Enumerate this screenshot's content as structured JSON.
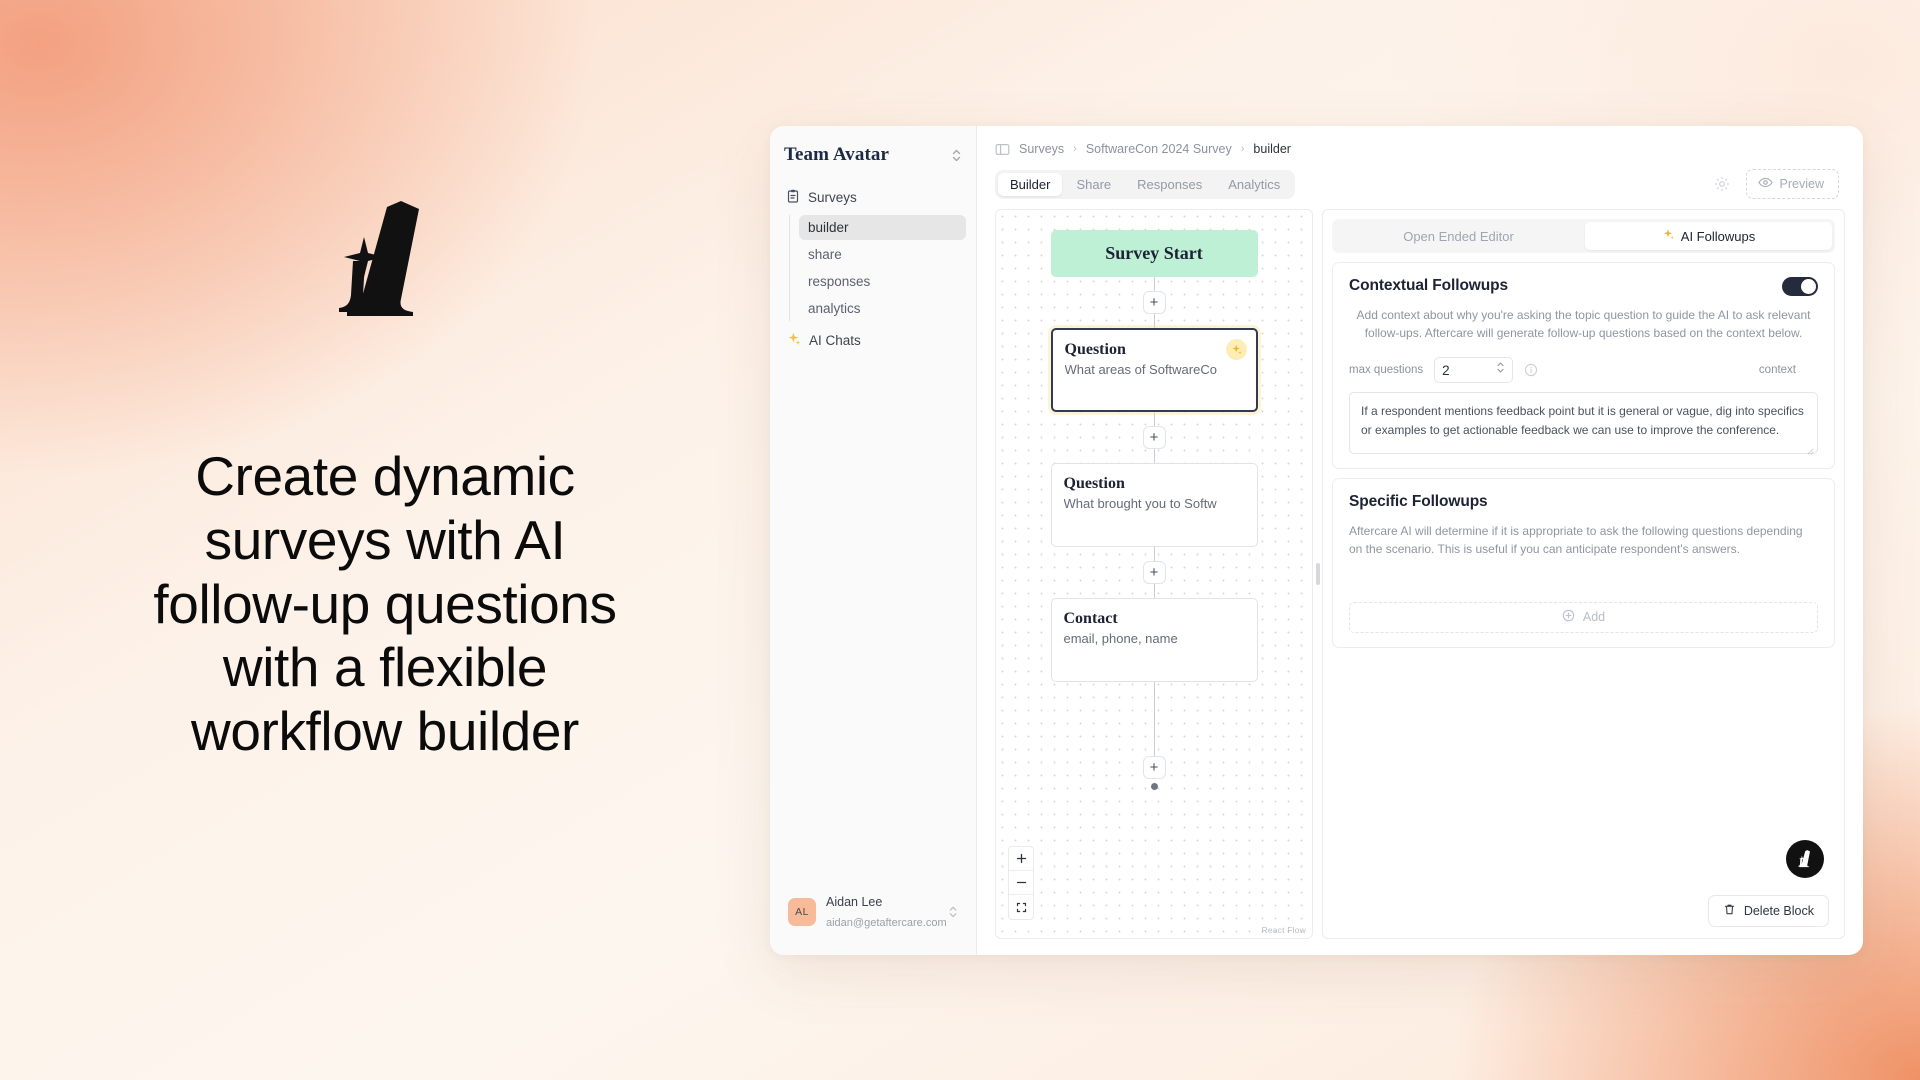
{
  "marketing": {
    "logo_icon": "aftercare-a-sparkle-logo",
    "headline": "Create dynamic surveys with AI follow-up questions with a flexible workflow builder"
  },
  "sidebar": {
    "team_name": "Team Avatar",
    "team_switcher_icon": "chevron-up-down-icon",
    "nav": {
      "group_label": "Surveys",
      "group_icon": "clipboard-icon",
      "children": [
        {
          "label": "builder",
          "active": true
        },
        {
          "label": "share",
          "active": false
        },
        {
          "label": "responses",
          "active": false
        },
        {
          "label": "analytics",
          "active": false
        }
      ],
      "ai_chats": {
        "label": "AI Chats",
        "icon": "sparkle-icon"
      }
    },
    "user": {
      "initials": "AL",
      "name": "Aidan Lee",
      "email": "aidan@getaftercare.com",
      "switcher_icon": "chevron-up-down-icon"
    }
  },
  "topbar": {
    "panel_toggle_icon": "sidebar-toggle-icon",
    "breadcrumbs": [
      "Surveys",
      "SoftwareCon 2024 Survey",
      "builder"
    ],
    "breadcrumb_separator": "›",
    "tabs": [
      {
        "label": "Builder",
        "active": true
      },
      {
        "label": "Share",
        "active": false
      },
      {
        "label": "Responses",
        "active": false
      },
      {
        "label": "Analytics",
        "active": false
      }
    ],
    "settings_icon": "gear-icon",
    "preview_label": "Preview",
    "preview_icon": "eye-icon"
  },
  "canvas": {
    "nodes": [
      {
        "type": "start",
        "title": "Survey Start",
        "subtitle": "",
        "selected": false,
        "badge": null
      },
      {
        "type": "question",
        "title": "Question",
        "subtitle": "What areas of SoftwareCo",
        "selected": true,
        "badge": "sparkle-icon"
      },
      {
        "type": "question",
        "title": "Question",
        "subtitle": "What brought you to Softw",
        "selected": false,
        "badge": null
      },
      {
        "type": "contact",
        "title": "Contact",
        "subtitle": "email, phone, name",
        "selected": false,
        "badge": null
      }
    ],
    "add_node_label": "+",
    "zoom_in_icon": "plus-icon",
    "zoom_out_icon": "minus-icon",
    "fit_view_icon": "fit-view-icon",
    "attribution": "React Flow",
    "drag_handle_icon": "vertical-grip-icon"
  },
  "inspector": {
    "segments": [
      {
        "label": "Open Ended Editor",
        "active": false,
        "icon": null
      },
      {
        "label": "AI Followups",
        "active": true,
        "icon": "sparkle-icon"
      }
    ],
    "contextual": {
      "title": "Contextual Followups",
      "enabled": true,
      "description": "Add context about why you're asking the topic question to guide the AI to ask relevant follow-ups. Aftercare will generate follow-up questions based on the context below.",
      "max_questions_label": "max questions",
      "max_questions_value": "2",
      "stepper_icon": "chevron-up-down-icon",
      "info_icon": "info-circle-icon",
      "context_label": "context",
      "context_value": "If a respondent mentions feedback point but it is general or vague, dig into specifics or examples to get actionable feedback we can use to improve the conference.",
      "resize_icon": "resize-grip-icon"
    },
    "specific": {
      "title": "Specific Followups",
      "description": "Aftercare AI will determine if it is appropriate to ask the following questions depending on the scenario. This is useful if you can anticipate respondent's answers.",
      "add_label": "Add",
      "add_icon": "plus-circle-icon"
    },
    "delete_label": "Delete Block",
    "delete_icon": "trash-icon"
  },
  "fab": {
    "icon": "aftercare-a-logo-icon"
  },
  "colors": {
    "accent_peach": "#f3a181",
    "start_node_green": "#bdf0d4",
    "toggle_on": "#242b3d",
    "badge_yellow": "#fdeeb8",
    "selected_border": "#323b4f"
  }
}
